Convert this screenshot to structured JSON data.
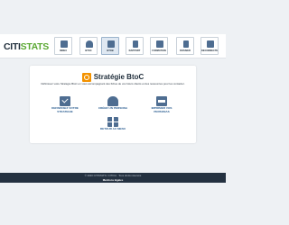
{
  "brand": {
    "part1": "CITI",
    "part2": "STATS"
  },
  "nav": [
    {
      "label": "Index"
    },
    {
      "label": "BToC"
    },
    {
      "label": "BToB"
    },
    {
      "label": "Rapport"
    },
    {
      "label": "Formation"
    },
    {
      "label": "Dossier"
    },
    {
      "label": "Deconnecter"
    }
  ],
  "page": {
    "title": "Stratégie BtoC",
    "subtitle": "Définissez votre Stratégie BtoC en vous accompagnant des fiches de vos futurs clients et des ressources pour les contacter."
  },
  "options": [
    {
      "label": "DEFINISSEZ VOTRE STRATEGIE"
    },
    {
      "label": "CRÉER UN PERSONA"
    },
    {
      "label": "IMPRIMER VOS PERSONAS"
    },
    {
      "label": "RETOUR AU MENU"
    }
  ],
  "footer": {
    "copyright": "© 2020 CITISTATS / CITICA · Tous droits réservés",
    "links": "Mentions légales"
  }
}
